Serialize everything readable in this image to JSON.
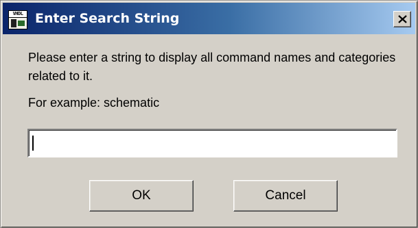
{
  "window": {
    "title": "Enter Search String",
    "app_icon": "vhdl-app-icon",
    "app_icon_text": "VHDL",
    "close_icon": "close-icon",
    "close_glyph": "×"
  },
  "dialog": {
    "message": "Please enter a string to display all command names and categories related to it.",
    "example": "For example: schematic"
  },
  "search": {
    "value": "",
    "placeholder": ""
  },
  "buttons": {
    "ok_label": "OK",
    "cancel_label": "Cancel"
  },
  "colors": {
    "titlebar_start": "#0a246a",
    "titlebar_end": "#a6caf0",
    "face": "#d4d0c8"
  }
}
